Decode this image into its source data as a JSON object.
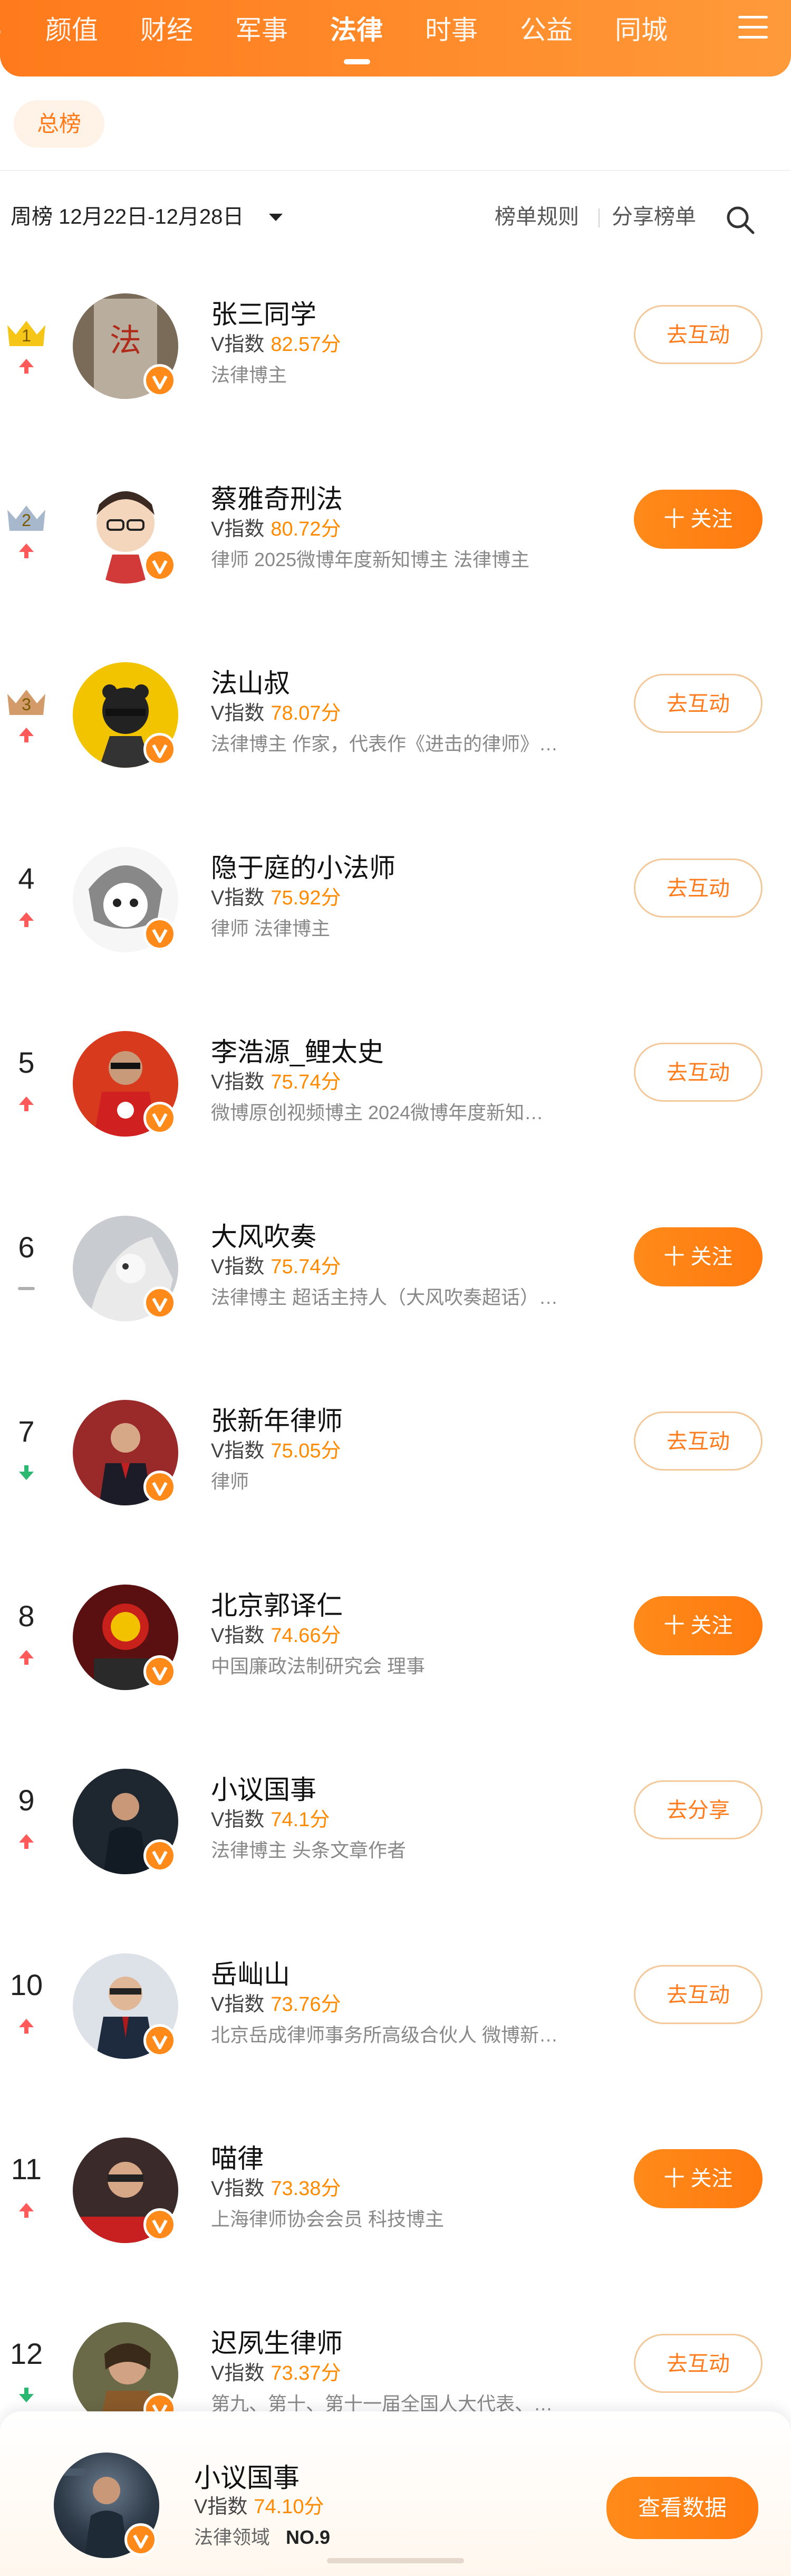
{
  "nav": {
    "tabs": [
      "颜值",
      "财经",
      "军事",
      "法律",
      "时事",
      "公益",
      "同城"
    ],
    "active_tab": "法律"
  },
  "category": {
    "pill_label": "总榜"
  },
  "toolbar": {
    "week_label": "周榜 12月22日-12月28日",
    "rules_label": "榜单规则",
    "share_label": "分享榜单"
  },
  "index_label": "V指数",
  "ranking": [
    {
      "rank": "1",
      "name": "张三同学",
      "score": "82.57分",
      "desc": "法律博主",
      "button": "去互动",
      "button_style": "outline",
      "trend": "up"
    },
    {
      "rank": "2",
      "name": "蔡雅奇刑法",
      "score": "80.72分",
      "desc": "律师 2025微博年度新知博主 法律博主",
      "button": "十 关注",
      "button_style": "follow",
      "trend": "up"
    },
    {
      "rank": "3",
      "name": "法山叔",
      "score": "78.07分",
      "desc": "法律博主 作家，代表作《进击的律师》…",
      "button": "去互动",
      "button_style": "outline",
      "trend": "up"
    },
    {
      "rank": "4",
      "name": "隐于庭的小法师",
      "score": "75.92分",
      "desc": "律师 法律博主",
      "button": "去互动",
      "button_style": "outline",
      "trend": "up"
    },
    {
      "rank": "5",
      "name": "李浩源_鲤太史",
      "score": "75.74分",
      "desc": "微博原创视频博主 2024微博年度新知…",
      "button": "去互动",
      "button_style": "outline",
      "trend": "up"
    },
    {
      "rank": "6",
      "name": "大风吹奏",
      "score": "75.74分",
      "desc": "法律博主 超话主持人（大风吹奏超话）…",
      "button": "十 关注",
      "button_style": "follow",
      "trend": "flat"
    },
    {
      "rank": "7",
      "name": "张新年律师",
      "score": "75.05分",
      "desc": "律师",
      "button": "去互动",
      "button_style": "outline",
      "trend": "down"
    },
    {
      "rank": "8",
      "name": "北京郭译仁",
      "score": "74.66分",
      "desc": "中国廉政法制研究会 理事",
      "button": "十 关注",
      "button_style": "follow",
      "trend": "up"
    },
    {
      "rank": "9",
      "name": "小议国事",
      "score": "74.1分",
      "desc": "法律博主 头条文章作者",
      "button": "去分享",
      "button_style": "outline",
      "trend": "up"
    },
    {
      "rank": "10",
      "name": "岳屾山",
      "score": "73.76分",
      "desc": "北京岳成律师事务所高级合伙人 微博新…",
      "button": "去互动",
      "button_style": "outline",
      "trend": "up"
    },
    {
      "rank": "11",
      "name": "喵律",
      "score": "73.38分",
      "desc": "上海律师协会会员 科技博主",
      "button": "十 关注",
      "button_style": "follow",
      "trend": "up"
    },
    {
      "rank": "12",
      "name": "迟夙生律师",
      "score": "73.37分",
      "desc": "第九、第十、第十一届全国人大代表、…",
      "button": "去互动",
      "button_style": "outline",
      "trend": "down"
    }
  ],
  "my_card": {
    "name": "小议国事",
    "score": "74.10分",
    "field_label": "法律领域",
    "rank_no": "NO.9",
    "button": "查看数据"
  },
  "colors": {
    "brand": "#ff7a1a",
    "score": "#ff8a00",
    "up": "#ff5a5a",
    "down": "#2cb870",
    "flat": "#b0b0b0"
  }
}
